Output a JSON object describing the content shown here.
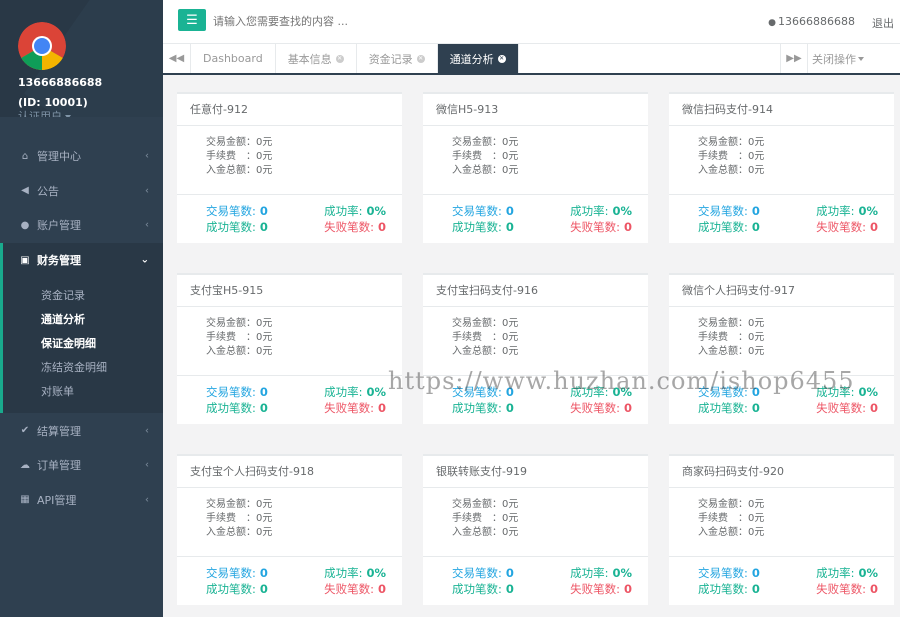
{
  "profile": {
    "username": "13666886688",
    "user_id": "(ID: 10001)",
    "role": "认证用户"
  },
  "sidebar": {
    "items": [
      {
        "label": "管理中心",
        "icon": "home-icon"
      },
      {
        "label": "公告",
        "icon": "volume-icon"
      },
      {
        "label": "账户管理",
        "icon": "user-icon"
      },
      {
        "label": "财务管理",
        "icon": "money-icon",
        "active": true
      },
      {
        "label": "结算管理",
        "icon": "check-icon"
      },
      {
        "label": "订单管理",
        "icon": "cloud-icon"
      },
      {
        "label": "API管理",
        "icon": "bank-icon"
      }
    ],
    "subitems": [
      {
        "label": "资金记录"
      },
      {
        "label": "通道分析"
      },
      {
        "label": "保证金明细"
      },
      {
        "label": "冻结资金明细"
      },
      {
        "label": "对账单"
      }
    ]
  },
  "topbar": {
    "menu_icon": "bars-icon",
    "search_placeholder": "请输入您需要查找的内容 ...",
    "user_tel": "13666886688",
    "logout": "退出"
  },
  "tabs": {
    "items": [
      {
        "label": "Dashboard",
        "closable": false
      },
      {
        "label": "基本信息",
        "closable": true
      },
      {
        "label": "资金记录",
        "closable": true
      },
      {
        "label": "通道分析",
        "closable": true,
        "active": true
      }
    ],
    "close_ops": "关闭操作"
  },
  "labels": {
    "trade_amount": "交易金额：",
    "fee": "手续费　：",
    "deposit_total": "入金总额：",
    "trade_count": "交易笔数:",
    "success_rate": "成功率:",
    "success_count": "成功笔数:",
    "fail_count": "失败笔数:"
  },
  "channels": [
    {
      "title": "任意付-912",
      "trade_amount": "0元",
      "fee": "0元",
      "deposit_total": "0元",
      "trade_count": "0",
      "success_rate": "0%",
      "success_count": "0",
      "fail_count": "0"
    },
    {
      "title": "微信H5-913",
      "trade_amount": "0元",
      "fee": "0元",
      "deposit_total": "0元",
      "trade_count": "0",
      "success_rate": "0%",
      "success_count": "0",
      "fail_count": "0"
    },
    {
      "title": "微信扫码支付-914",
      "trade_amount": "0元",
      "fee": "0元",
      "deposit_total": "0元",
      "trade_count": "0",
      "success_rate": "0%",
      "success_count": "0",
      "fail_count": "0"
    },
    {
      "title": "支付宝H5-915",
      "trade_amount": "0元",
      "fee": "0元",
      "deposit_total": "0元",
      "trade_count": "0",
      "success_rate": "0%",
      "success_count": "0",
      "fail_count": "0"
    },
    {
      "title": "支付宝扫码支付-916",
      "trade_amount": "0元",
      "fee": "0元",
      "deposit_total": "0元",
      "trade_count": "0",
      "success_rate": "0%",
      "success_count": "0",
      "fail_count": "0"
    },
    {
      "title": "微信个人扫码支付-917",
      "trade_amount": "0元",
      "fee": "0元",
      "deposit_total": "0元",
      "trade_count": "0",
      "success_rate": "0%",
      "success_count": "0",
      "fail_count": "0"
    },
    {
      "title": "支付宝个人扫码支付-918",
      "trade_amount": "0元",
      "fee": "0元",
      "deposit_total": "0元",
      "trade_count": "0",
      "success_rate": "0%",
      "success_count": "0",
      "fail_count": "0"
    },
    {
      "title": "银联转账支付-919",
      "trade_amount": "0元",
      "fee": "0元",
      "deposit_total": "0元",
      "trade_count": "0",
      "success_rate": "0%",
      "success_count": "0",
      "fail_count": "0"
    },
    {
      "title": "商家码扫码支付-920",
      "trade_amount": "0元",
      "fee": "0元",
      "deposit_total": "0元",
      "trade_count": "0",
      "success_rate": "0%",
      "success_count": "0",
      "fail_count": "0"
    }
  ],
  "watermark": "https://www.huzhan.com/ishop6455",
  "colors": {
    "sidebar_bg": "#2f4050",
    "accent": "#1ab394",
    "blue": "#23a5e0",
    "red": "#ed5565"
  }
}
